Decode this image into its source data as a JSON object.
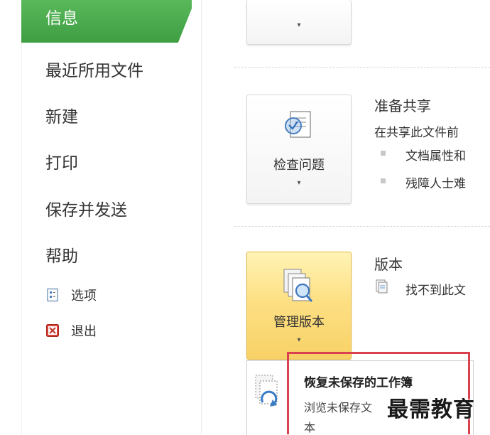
{
  "nav": {
    "active": "信息",
    "items": [
      "最近所用文件",
      "新建",
      "打印",
      "保存并发送",
      "帮助"
    ],
    "options": "选项",
    "exit": "退出"
  },
  "prepare_share": {
    "button_label": "检查问题",
    "title": "准备共享",
    "desc": "在共享此文件前",
    "bullets": [
      "文档属性和",
      "残障人士难"
    ]
  },
  "versions": {
    "button_label": "管理版本",
    "title": "版本",
    "desc": "找不到此文"
  },
  "recover": {
    "title": "恢复未保存的工作簿",
    "desc_line1": "浏览未保存文",
    "desc_line2": "本"
  },
  "watermark": "最需教育",
  "colors": {
    "active_green": "#4aaa4c",
    "highlight_red": "#d9414e",
    "hot_button": "#fde084"
  }
}
